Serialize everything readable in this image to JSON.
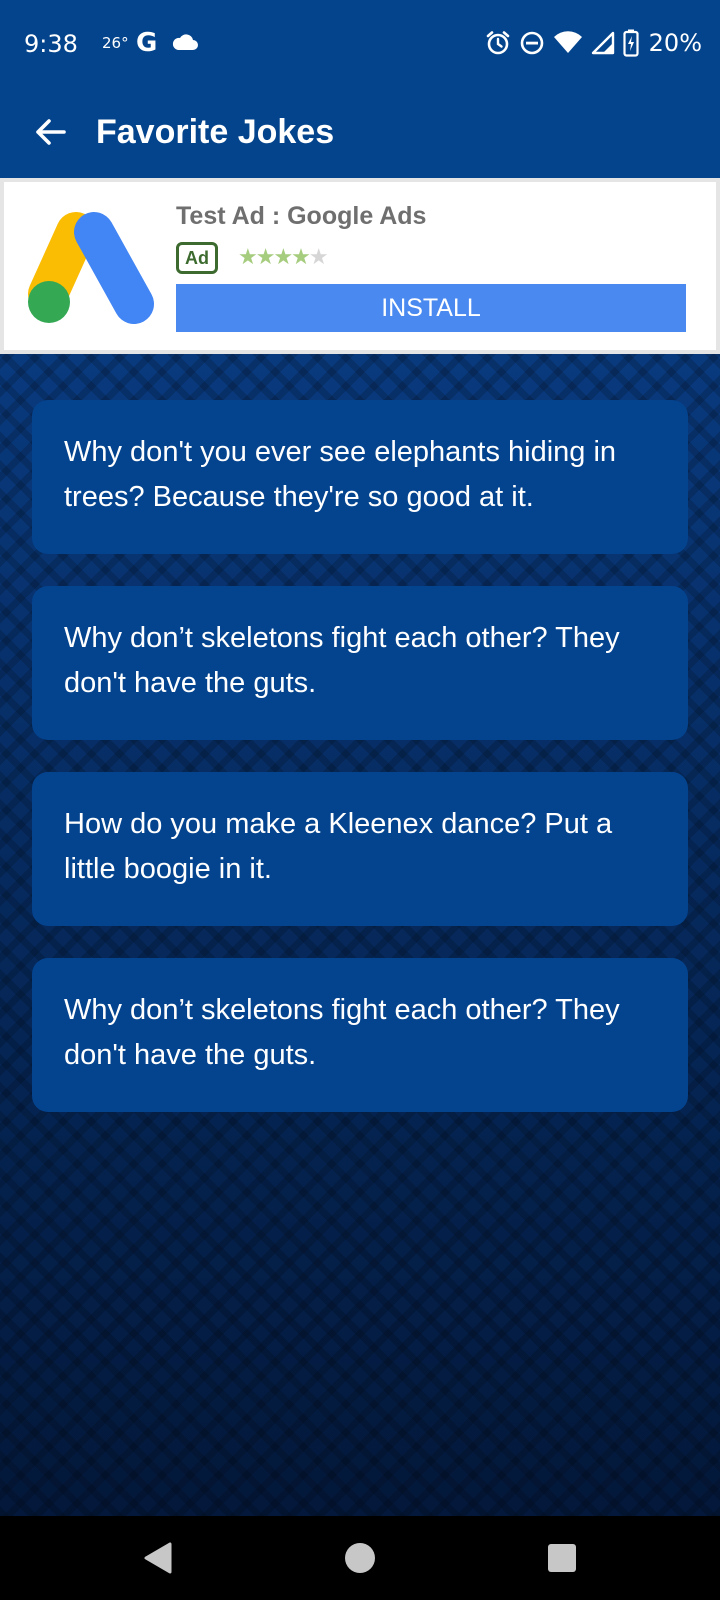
{
  "status_bar": {
    "time": "9:38",
    "temperature": "26°",
    "google_letter": "G",
    "battery": "20%",
    "icons": [
      "cloud-icon",
      "alarm-icon",
      "dnd-icon",
      "wifi-icon",
      "signal-icon",
      "battery-icon"
    ]
  },
  "app_bar": {
    "title": "Favorite Jokes",
    "back_icon": "arrow-left-icon"
  },
  "ad": {
    "title": "Test Ad : Google Ads",
    "badge": "Ad",
    "rating": 4.5,
    "stars": "★★★★",
    "star_half": "★",
    "install_label": "INSTALL",
    "install_color": "#4a89f0"
  },
  "jokes": [
    "Why don't you ever see elephants hiding in trees? Because they're so good at it.",
    "Why don’t skeletons fight each other? They don't have the guts.",
    "How do you make a Kleenex dance? Put a little boogie in it.",
    "Why don’t skeletons fight each other? They don't have the guts."
  ],
  "nav_bar": {
    "buttons": [
      "back-triangle-icon",
      "home-circle-icon",
      "recents-square-icon"
    ]
  },
  "colors": {
    "primary": "#04448c",
    "card": "#04438e",
    "background_dark": "#06214d"
  }
}
